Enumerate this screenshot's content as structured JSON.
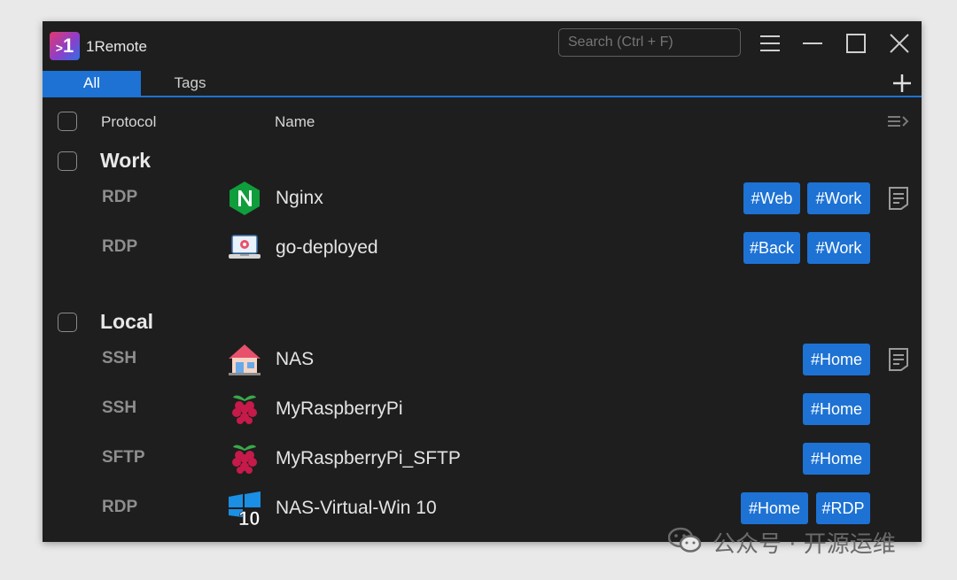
{
  "window": {
    "title": "1Remote",
    "logo_text": "1"
  },
  "search": {
    "placeholder": "Search (Ctrl + F)"
  },
  "tabs": [
    {
      "label": "All",
      "active": true
    },
    {
      "label": "Tags",
      "active": false
    }
  ],
  "columns": {
    "protocol": "Protocol",
    "name": "Name"
  },
  "groups": [
    {
      "name": "Work",
      "items": [
        {
          "protocol": "RDP",
          "name": "Nginx",
          "icon": "nginx-icon",
          "tags": [
            "#Web",
            "#Work"
          ],
          "has_note": true
        },
        {
          "protocol": "RDP",
          "name": "go-deployed",
          "icon": "laptop-gear-icon",
          "tags": [
            "#Back",
            "#Work"
          ],
          "has_note": false
        }
      ]
    },
    {
      "name": "Local",
      "items": [
        {
          "protocol": "SSH",
          "name": "NAS",
          "icon": "house-icon",
          "tags": [
            "#Home"
          ],
          "has_note": true
        },
        {
          "protocol": "SSH",
          "name": "MyRaspberryPi",
          "icon": "raspberry-icon",
          "tags": [
            "#Home"
          ],
          "has_note": false
        },
        {
          "protocol": "SFTP",
          "name": "MyRaspberryPi_SFTP",
          "icon": "raspberry-icon",
          "tags": [
            "#Home"
          ],
          "has_note": false
        },
        {
          "protocol": "RDP",
          "name": "NAS-Virtual-Win 10",
          "icon": "windows-10-icon",
          "tags": [
            "#Home",
            "#RDP"
          ],
          "has_note": false
        }
      ]
    }
  ],
  "watermark": {
    "text": "公众号 · 开源运维"
  },
  "colors": {
    "accent": "#1d72d4",
    "window_bg": "#1e1e1e",
    "page_bg": "#e9e9e9"
  }
}
